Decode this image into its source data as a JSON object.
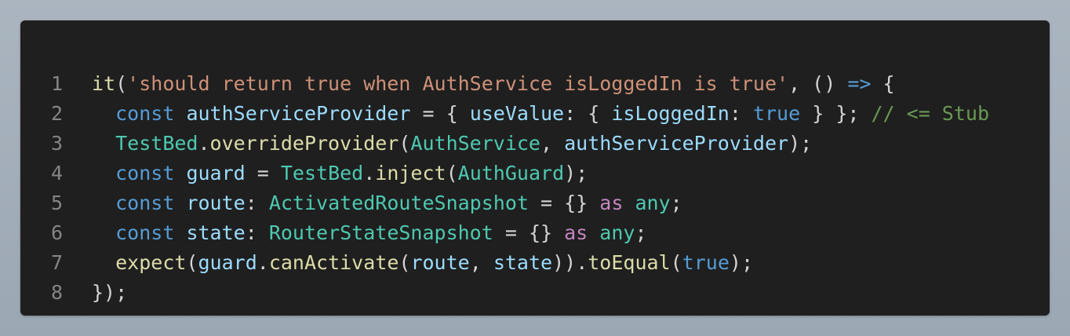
{
  "colors": {
    "background": "#a3aeb9",
    "card": "#1f1f1f",
    "line_number": "#858585",
    "plain": "#d4d4d4",
    "keyword": "#569cd6",
    "function": "#dcdcaa",
    "string": "#ce9178",
    "variable": "#9cdcfe",
    "type": "#4ec9b0",
    "comment": "#6a9955",
    "control": "#c586c0"
  },
  "code": {
    "lines": [
      {
        "number": "1",
        "tokens": [
          {
            "t": "it",
            "k": "fn"
          },
          {
            "t": "(",
            "k": "op"
          },
          {
            "t": "'should return true when AuthService isLoggedIn is true'",
            "k": "str"
          },
          {
            "t": ", () ",
            "k": "op"
          },
          {
            "t": "=>",
            "k": "arrow"
          },
          {
            "t": " {",
            "k": "op"
          }
        ]
      },
      {
        "number": "2",
        "tokens": [
          {
            "t": "  ",
            "k": "op"
          },
          {
            "t": "const",
            "k": "kw"
          },
          {
            "t": " ",
            "k": "op"
          },
          {
            "t": "authServiceProvider",
            "k": "var"
          },
          {
            "t": " = { ",
            "k": "op"
          },
          {
            "t": "useValue",
            "k": "var"
          },
          {
            "t": ": { ",
            "k": "op"
          },
          {
            "t": "isLoggedIn",
            "k": "var"
          },
          {
            "t": ": ",
            "k": "op"
          },
          {
            "t": "true",
            "k": "kw"
          },
          {
            "t": " } }; ",
            "k": "op"
          },
          {
            "t": "// <= Stub",
            "k": "cmt"
          }
        ]
      },
      {
        "number": "3",
        "tokens": [
          {
            "t": "  ",
            "k": "op"
          },
          {
            "t": "TestBed",
            "k": "type"
          },
          {
            "t": ".",
            "k": "op"
          },
          {
            "t": "overrideProvider",
            "k": "fn"
          },
          {
            "t": "(",
            "k": "op"
          },
          {
            "t": "AuthService",
            "k": "type"
          },
          {
            "t": ", ",
            "k": "op"
          },
          {
            "t": "authServiceProvider",
            "k": "var"
          },
          {
            "t": ");",
            "k": "op"
          }
        ]
      },
      {
        "number": "4",
        "tokens": [
          {
            "t": "  ",
            "k": "op"
          },
          {
            "t": "const",
            "k": "kw"
          },
          {
            "t": " ",
            "k": "op"
          },
          {
            "t": "guard",
            "k": "var"
          },
          {
            "t": " = ",
            "k": "op"
          },
          {
            "t": "TestBed",
            "k": "type"
          },
          {
            "t": ".",
            "k": "op"
          },
          {
            "t": "inject",
            "k": "fn"
          },
          {
            "t": "(",
            "k": "op"
          },
          {
            "t": "AuthGuard",
            "k": "type"
          },
          {
            "t": ");",
            "k": "op"
          }
        ]
      },
      {
        "number": "5",
        "tokens": [
          {
            "t": "  ",
            "k": "op"
          },
          {
            "t": "const",
            "k": "kw"
          },
          {
            "t": " ",
            "k": "op"
          },
          {
            "t": "route",
            "k": "var"
          },
          {
            "t": ": ",
            "k": "op"
          },
          {
            "t": "ActivatedRouteSnapshot",
            "k": "type"
          },
          {
            "t": " = {} ",
            "k": "op"
          },
          {
            "t": "as",
            "k": "ctl"
          },
          {
            "t": " ",
            "k": "op"
          },
          {
            "t": "any",
            "k": "type"
          },
          {
            "t": ";",
            "k": "op"
          }
        ]
      },
      {
        "number": "6",
        "tokens": [
          {
            "t": "  ",
            "k": "op"
          },
          {
            "t": "const",
            "k": "kw"
          },
          {
            "t": " ",
            "k": "op"
          },
          {
            "t": "state",
            "k": "var"
          },
          {
            "t": ": ",
            "k": "op"
          },
          {
            "t": "RouterStateSnapshot",
            "k": "type"
          },
          {
            "t": " = {} ",
            "k": "op"
          },
          {
            "t": "as",
            "k": "ctl"
          },
          {
            "t": " ",
            "k": "op"
          },
          {
            "t": "any",
            "k": "type"
          },
          {
            "t": ";",
            "k": "op"
          }
        ]
      },
      {
        "number": "7",
        "tokens": [
          {
            "t": "  ",
            "k": "op"
          },
          {
            "t": "expect",
            "k": "fn"
          },
          {
            "t": "(",
            "k": "op"
          },
          {
            "t": "guard",
            "k": "var"
          },
          {
            "t": ".",
            "k": "op"
          },
          {
            "t": "canActivate",
            "k": "fn"
          },
          {
            "t": "(",
            "k": "op"
          },
          {
            "t": "route",
            "k": "var"
          },
          {
            "t": ", ",
            "k": "op"
          },
          {
            "t": "state",
            "k": "var"
          },
          {
            "t": ")).",
            "k": "op"
          },
          {
            "t": "toEqual",
            "k": "fn"
          },
          {
            "t": "(",
            "k": "op"
          },
          {
            "t": "true",
            "k": "kw"
          },
          {
            "t": ");",
            "k": "op"
          }
        ]
      },
      {
        "number": "8",
        "tokens": [
          {
            "t": "});",
            "k": "op"
          }
        ]
      }
    ]
  }
}
